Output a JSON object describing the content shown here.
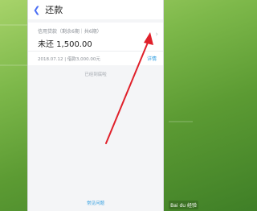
{
  "header": {
    "title": "还款"
  },
  "loan": {
    "label": "信用贷款（剩余6期｜共6期）",
    "amount": "未还 1,500.00",
    "date_and_amount": "2018.07.12 | 借款3,000.00元",
    "detail_link": "详情"
  },
  "notes": {
    "bottom": "已经到底啦",
    "faq": "常见问题"
  },
  "watermark": "Bai du 经验",
  "colors": {
    "accent": "#2e9de0",
    "arrow": "#e0202a"
  }
}
